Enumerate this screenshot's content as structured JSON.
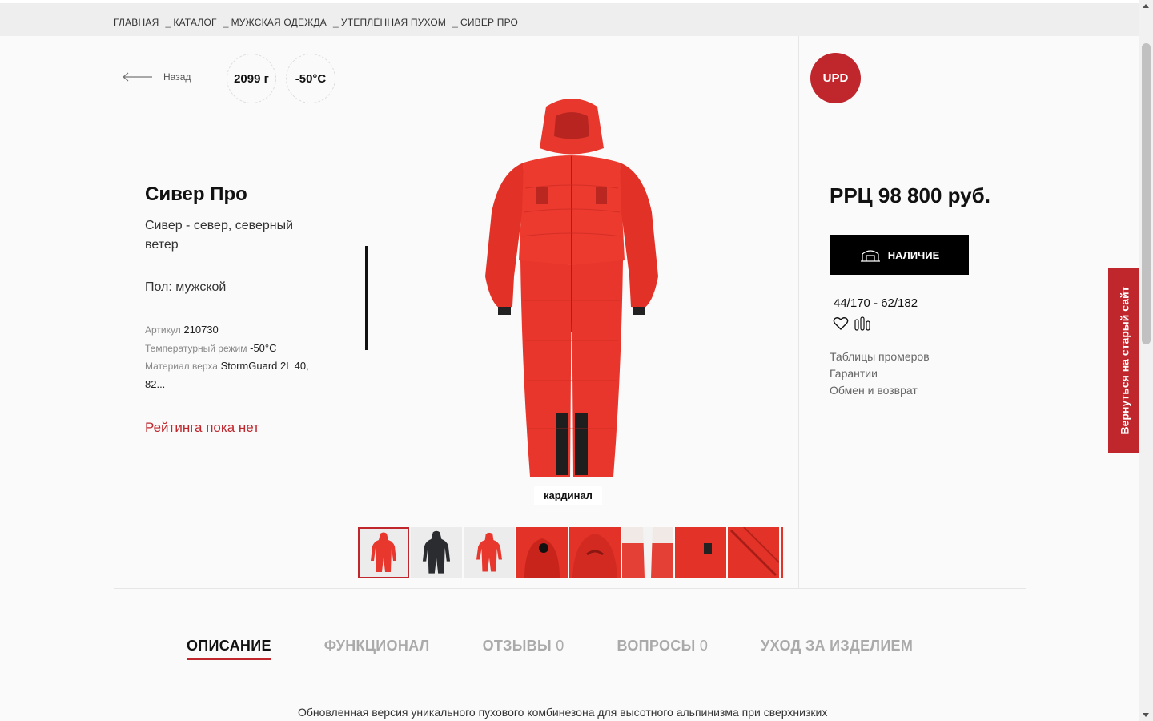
{
  "breadcrumb": {
    "items": [
      "ГЛАВНАЯ",
      "КАТАЛОГ",
      "МУЖСКАЯ ОДЕЖДА",
      "УТЕПЛЁННАЯ ПУХОМ",
      "СИВЕР ПРО"
    ],
    "separator": "_"
  },
  "left": {
    "back_label": "Назад",
    "weight_badge": "2099 г",
    "temp_badge": "-50°C",
    "title": "Сивер Про",
    "subtitle": "Сивер - север, северный ветер",
    "gender": "Пол: мужской",
    "specs": {
      "article_label": "Артикул",
      "article_value": "210730",
      "temp_label": "Температурный режим",
      "temp_value": "-50°C",
      "material_label": "Материал верха",
      "material_value": "StormGuard 2L 40, 82..."
    },
    "rating": "Рейтинга пока нет"
  },
  "gallery": {
    "color_label": "кардинал",
    "thumbnails": [
      {
        "name": "thumb-front-red",
        "color": "#e8382e",
        "selected": true
      },
      {
        "name": "thumb-front-black",
        "color": "#2a2c30",
        "selected": false
      },
      {
        "name": "thumb-back-red",
        "color": "#e8382e",
        "selected": false
      },
      {
        "name": "thumb-hood-red",
        "color": "#e33228",
        "selected": false
      },
      {
        "name": "thumb-hood-closeup",
        "color": "#e33228",
        "selected": false
      },
      {
        "name": "thumb-collar-detail",
        "color": "#e54036",
        "selected": false
      },
      {
        "name": "thumb-pocket-detail",
        "color": "#e33228",
        "selected": false
      },
      {
        "name": "thumb-zip-detail",
        "color": "#e33228",
        "selected": false
      },
      {
        "name": "thumb-fabric-detail",
        "color": "#e33228",
        "selected": false
      }
    ]
  },
  "right": {
    "upd_badge": "UPD",
    "price": "РРЦ 98 800 руб.",
    "stock_button": "НАЛИЧИЕ",
    "sizes": "44/170 - 62/182",
    "links": [
      "Таблицы промеров",
      "Гарантии",
      "Обмен и возврат"
    ]
  },
  "side_tab": "Вернуться на старый сайт",
  "tabs": [
    {
      "label": "ОПИСАНИЕ",
      "count": "",
      "active": true
    },
    {
      "label": "ФУНКЦИОНАЛ",
      "count": "",
      "active": false
    },
    {
      "label": "ОТЗЫВЫ",
      "count": "0",
      "active": false
    },
    {
      "label": "ВОПРОСЫ",
      "count": "0",
      "active": false
    },
    {
      "label": "УХОД ЗА ИЗДЕЛИЕМ",
      "count": "",
      "active": false
    }
  ],
  "description": "Обновленная версия уникального пухового комбинезона для высотного альпинизма при сверхнизких",
  "colors": {
    "accent": "#c0272d",
    "product": "#e8382e",
    "dark": "#000000"
  }
}
